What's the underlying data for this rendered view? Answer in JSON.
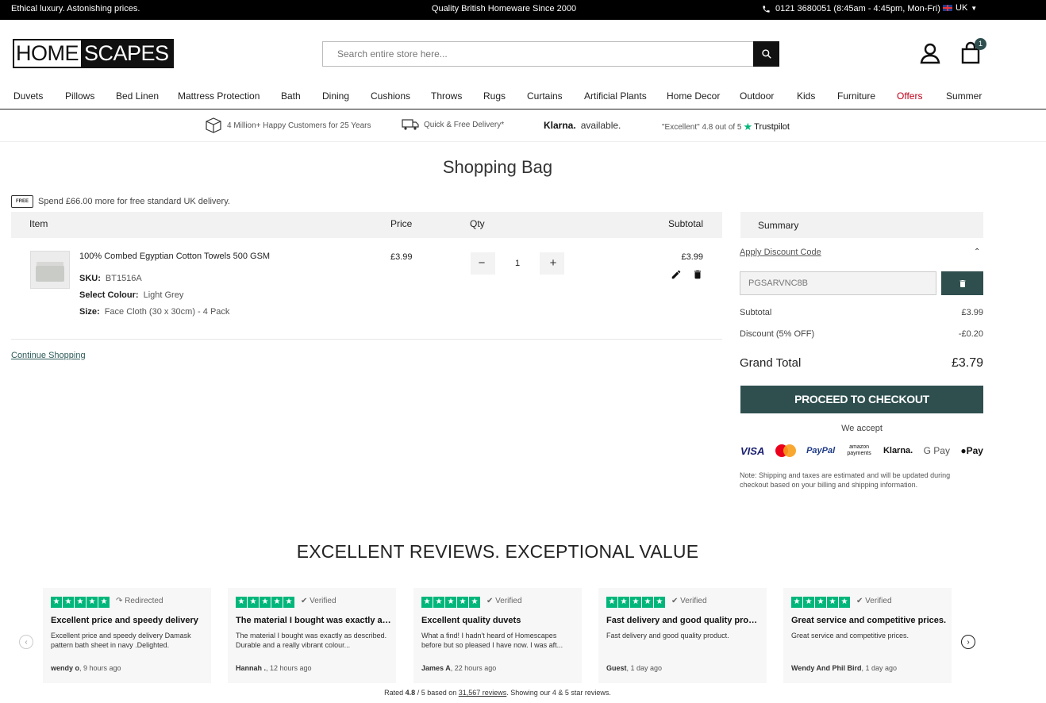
{
  "topbar": {
    "left": "Ethical luxury. Astonishing prices.",
    "center": "Quality British Homeware Since 2000",
    "phone": "0121 3680051 (8:45am - 4:45pm, Mon-Fri)",
    "locale": "UK"
  },
  "header": {
    "logo_a": "HOME",
    "logo_b": "SCAPES",
    "search_placeholder": "Search entire store here...",
    "cart_count": "1"
  },
  "nav": {
    "items": [
      "Duvets",
      "Pillows",
      "Bed Linen",
      "Mattress Protection",
      "Bath",
      "Dining",
      "Cushions",
      "Throws",
      "Rugs",
      "Curtains",
      "Artificial Plants",
      "Home Decor",
      "Outdoor",
      "Kids",
      "Furniture",
      "Offers",
      "Summer"
    ]
  },
  "trust": {
    "customers": "4 Million+ Happy Customers for 25 Years",
    "delivery": "Quick & Free Delivery*",
    "klarna": "Klarna.",
    "klarna_suffix": "available.",
    "trustpilot_rating": "\"Excellent\" 4.8 out of 5",
    "trustpilot": "Trustpilot"
  },
  "page": {
    "title": "Shopping Bag",
    "free_delivery": "Spend £66.00 more for free standard UK delivery.",
    "free_badge": "FREE"
  },
  "cart": {
    "headers": {
      "item": "Item",
      "price": "Price",
      "qty": "Qty",
      "subtotal": "Subtotal"
    },
    "item": {
      "name": "100% Combed Egyptian Cotton Towels 500 GSM",
      "sku_label": "SKU:",
      "sku": "BT1516A",
      "colour_label": "Select Colour:",
      "colour": "Light Grey",
      "size_label": "Size:",
      "size": "Face Cloth (30 x 30cm) - 4 Pack",
      "price": "£3.99",
      "qty": "1",
      "subtotal": "£3.99"
    },
    "continue": "Continue Shopping"
  },
  "summary": {
    "title": "Summary",
    "apply_discount": "Apply Discount Code",
    "discount_code": "PGSARVNC8B",
    "subtotal_label": "Subtotal",
    "subtotal": "£3.99",
    "discount_label": "Discount (5% OFF)",
    "discount": "-£0.20",
    "grand_label": "Grand Total",
    "grand": "£3.79",
    "checkout": "PROCEED TO CHECKOUT",
    "we_accept": "We accept",
    "payments": {
      "visa": "VISA",
      "paypal": "PayPal",
      "amazon": "amazon payments",
      "klarna": "Klarna.",
      "gpay": "G Pay",
      "apay": "Pay"
    },
    "note": "Note: Shipping and taxes are estimated and will be updated during checkout based on your billing and shipping information."
  },
  "reviews": {
    "title": "EXCELLENT REVIEWS. EXCEPTIONAL VALUE",
    "cards": [
      {
        "status": "Redirected",
        "title": "Excellent price and speedy delivery",
        "body": "Excellent price and speedy delivery Damask pattern bath sheet in navy .Delighted.",
        "author": "wendy o",
        "time": ", 9 hours ago"
      },
      {
        "status": "Verified",
        "title": "The material I bought was exactly as…",
        "body": "The material I bought was exactly as described. Durable and a really vibrant colour...",
        "author": "Hannah .",
        "time": ", 12 hours ago"
      },
      {
        "status": "Verified",
        "title": "Excellent quality duvets",
        "body": "What a find! I hadn't heard of Homescapes before but so pleased I have now. I was aft...",
        "author": "James A",
        "time": ", 22 hours ago"
      },
      {
        "status": "Verified",
        "title": "Fast delivery and good quality prod…",
        "body": "Fast delivery and good quality product.",
        "author": "Guest",
        "time": ", 1 day ago"
      },
      {
        "status": "Verified",
        "title": "Great service and competitive prices.",
        "body": "Great service and competitive prices.",
        "author": "Wendy And Phil Bird",
        "time": ", 1 day ago"
      }
    ],
    "rated_a": "Rated ",
    "rated_score": "4.8",
    "rated_b": " / 5 based on ",
    "rated_count": "31,567 reviews",
    "rated_c": ". Showing our 4 & 5 star reviews."
  }
}
